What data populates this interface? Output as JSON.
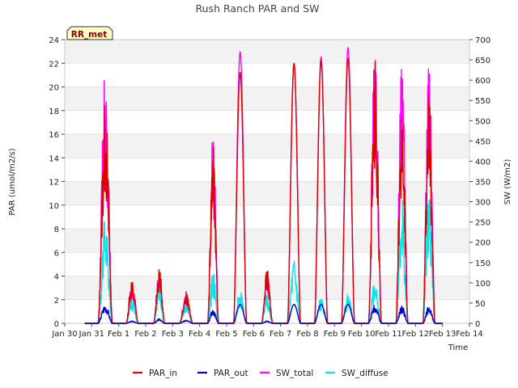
{
  "chart_data": {
    "type": "line",
    "title": "Rush Ranch PAR and SW",
    "xlabel": "Time",
    "ylabel_left": "PAR (umol/m2/s)",
    "ylabel_right": "SW (W/m2)",
    "ylim_left": [
      0,
      24
    ],
    "ylim_right": [
      0,
      700
    ],
    "yticks_left": [
      0,
      2,
      4,
      6,
      8,
      10,
      12,
      14,
      16,
      18,
      20,
      22,
      24
    ],
    "yticks_right": [
      0,
      50,
      100,
      150,
      200,
      250,
      300,
      350,
      400,
      450,
      500,
      550,
      600,
      650,
      700
    ],
    "xlim_days": [
      0,
      15
    ],
    "xtick_labels": [
      "Jan 30",
      "Jan 31",
      "Feb 1",
      "Feb 2",
      "Feb 3",
      "Feb 4",
      "Feb 5",
      "Feb 6",
      "Feb 7",
      "Feb 8",
      "Feb 9",
      "Feb 10",
      "Feb 11",
      "Feb 12",
      "Feb 13",
      "Feb 14"
    ],
    "grid": true,
    "legend_position": "bottom-center",
    "station_label": "RR_met",
    "days": [
      {
        "day": 1,
        "par_in": 19.0,
        "par_out": 1.6,
        "sw_total": 640,
        "sw_diffuse": 270
      },
      {
        "day": 2,
        "par_in": 3.9,
        "par_out": 0.2,
        "sw_total": 100,
        "sw_diffuse": 65
      },
      {
        "day": 3,
        "par_in": 4.8,
        "par_out": 0.4,
        "sw_total": 130,
        "sw_diffuse": 100
      },
      {
        "day": 4,
        "par_in": 2.7,
        "par_out": 0.3,
        "sw_total": 70,
        "sw_diffuse": 55
      },
      {
        "day": 5,
        "par_in": 15.8,
        "par_out": 1.2,
        "sw_total": 485,
        "sw_diffuse": 130
      },
      {
        "day": 6,
        "par_in": 21.2,
        "par_out": 1.6,
        "sw_total": 670,
        "sw_diffuse": 80
      },
      {
        "day": 7,
        "par_in": 4.7,
        "par_out": 0.2,
        "sw_total": 130,
        "sw_diffuse": 75
      },
      {
        "day": 8,
        "par_in": 22.0,
        "par_out": 1.6,
        "sw_total": 640,
        "sw_diffuse": 162
      },
      {
        "day": 9,
        "par_in": 22.2,
        "par_out": 1.6,
        "sw_total": 657,
        "sw_diffuse": 65
      },
      {
        "day": 10,
        "par_in": 22.4,
        "par_out": 1.6,
        "sw_total": 680,
        "sw_diffuse": 75
      },
      {
        "day": 11,
        "par_in": 22.8,
        "par_out": 1.6,
        "sw_total": 688,
        "sw_diffuse": 108
      },
      {
        "day": 12,
        "par_in": 19.9,
        "par_out": 1.5,
        "sw_total": 670,
        "sw_diffuse": 320
      },
      {
        "day": 13,
        "par_in": 20.8,
        "par_out": 1.5,
        "sw_total": 650,
        "sw_diffuse": 350
      }
    ],
    "series": [
      {
        "name": "PAR_in",
        "color": "#dd0000",
        "axis": "left"
      },
      {
        "name": "PAR_out",
        "color": "#0000cc",
        "axis": "left"
      },
      {
        "name": "SW_total",
        "color": "#ff00ff",
        "axis": "right"
      },
      {
        "name": "SW_diffuse",
        "color": "#00e5ee",
        "axis": "right"
      }
    ]
  }
}
